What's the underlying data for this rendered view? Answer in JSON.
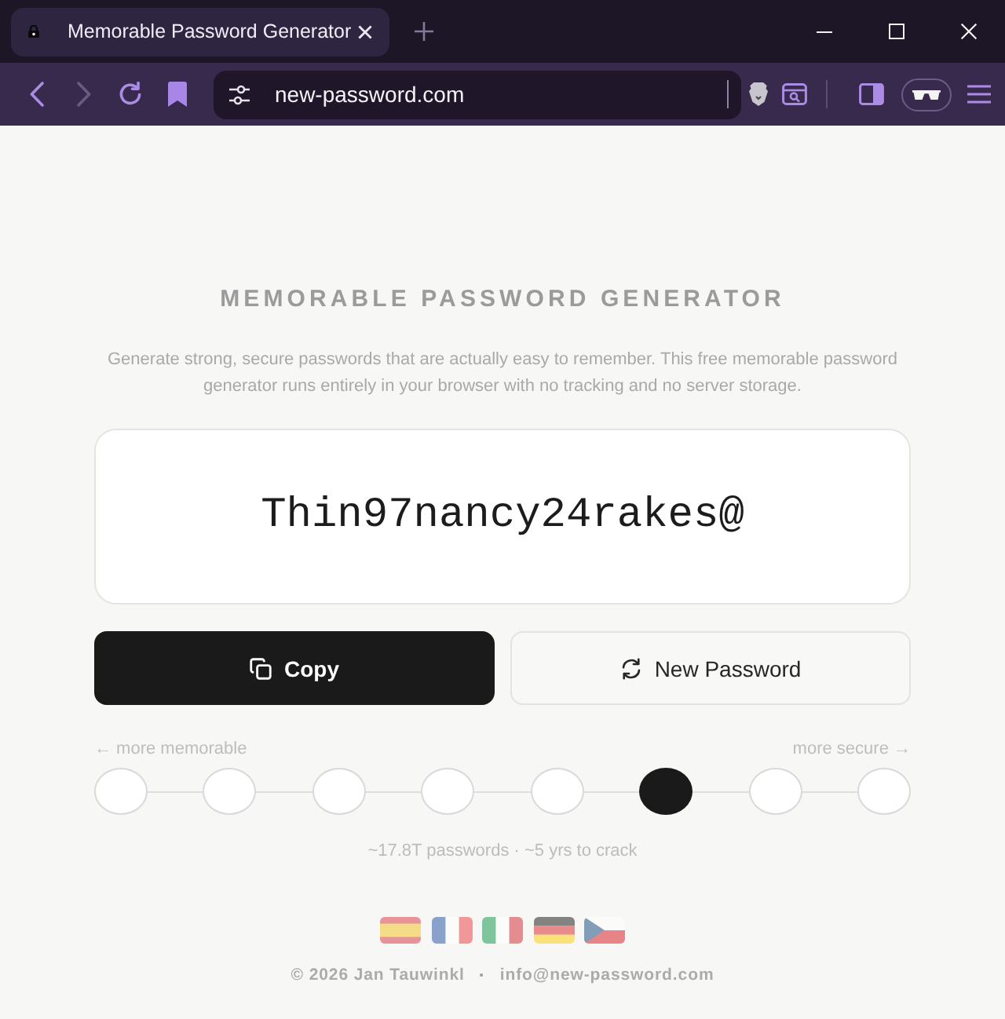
{
  "window": {
    "tab_title": "Memorable Password Generator",
    "url": "new-password.com"
  },
  "page": {
    "title": "MEMORABLE PASSWORD GENERATOR",
    "description": "Generate strong, secure passwords that are actually easy to remember. This free memorable password generator runs entirely in your browser with no tracking and no server storage.",
    "password": "Thin97nancy24rakes@",
    "buttons": [
      {
        "kind": "copy",
        "label": "Copy"
      },
      {
        "kind": "refresh",
        "label": "New Password"
      }
    ],
    "strength": {
      "left_label": "← more memorable",
      "right_label": "more secure →",
      "steps": [
        {
          "selected": false
        },
        {
          "selected": false
        },
        {
          "selected": false
        },
        {
          "selected": false
        },
        {
          "selected": false
        },
        {
          "selected": true
        },
        {
          "selected": false
        },
        {
          "selected": false
        }
      ]
    },
    "stats": "~17.8T passwords · ~5 yrs to crack",
    "footer": {
      "copyright": "© 2026 Jan Tauwinkl",
      "separator": "·",
      "email": "info@new-password.com"
    }
  }
}
